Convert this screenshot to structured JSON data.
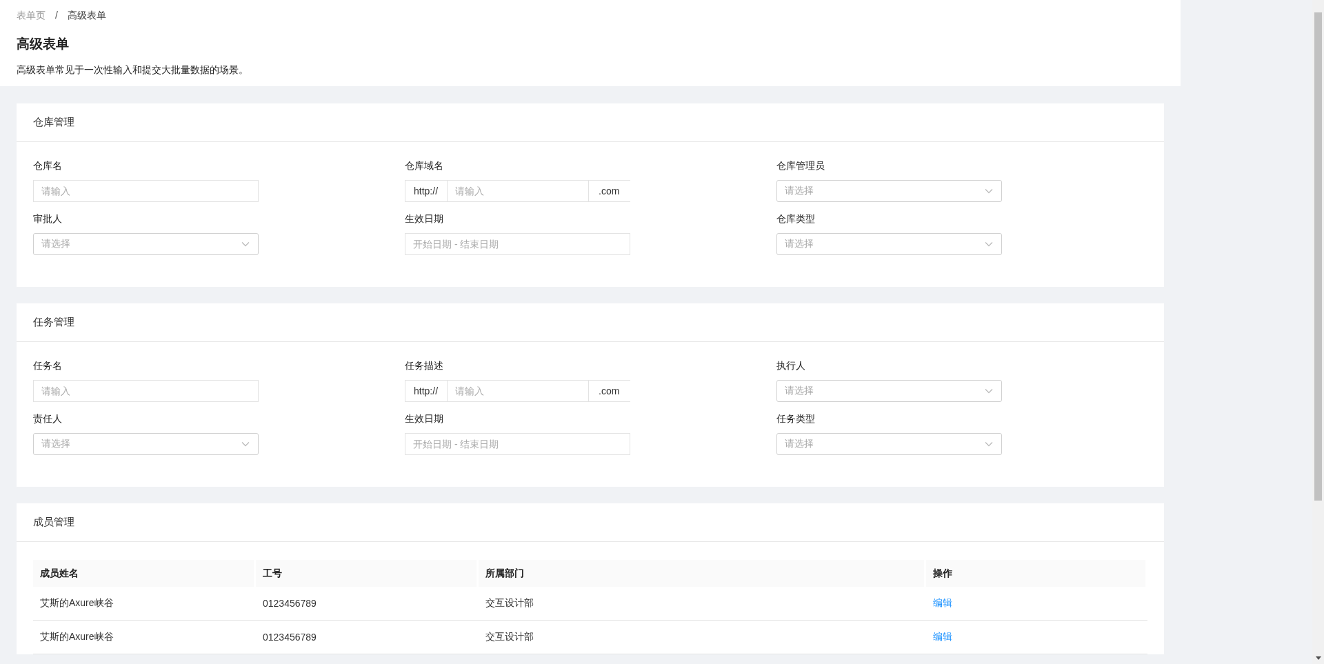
{
  "breadcrumb": [
    {
      "label": "表单页",
      "current": false
    },
    {
      "label": "高级表单",
      "current": true
    }
  ],
  "breadcrumb_separator": "/",
  "page": {
    "title": "高级表单",
    "description": "高级表单常见于一次性输入和提交大批量数据的场景。"
  },
  "sections": [
    {
      "title": "仓库管理",
      "kind": "form",
      "fields": [
        {
          "label": "仓库名",
          "kind": "input",
          "placeholder": "请输入"
        },
        {
          "label": "仓库域名",
          "kind": "addon_input",
          "prefix": "http://",
          "placeholder": "请输入",
          "suffix": ".com"
        },
        {
          "label": "仓库管理员",
          "kind": "select",
          "placeholder": "请选择"
        },
        {
          "label": "审批人",
          "kind": "select",
          "placeholder": "请选择"
        },
        {
          "label": "生效日期",
          "kind": "date_range",
          "placeholder": "开始日期 - 结束日期"
        },
        {
          "label": "仓库类型",
          "kind": "select",
          "placeholder": "请选择"
        }
      ]
    },
    {
      "title": "任务管理",
      "kind": "form",
      "fields": [
        {
          "label": "任务名",
          "kind": "input",
          "placeholder": "请输入"
        },
        {
          "label": "任务描述",
          "kind": "addon_input",
          "prefix": "http://",
          "placeholder": "请输入",
          "suffix": ".com"
        },
        {
          "label": "执行人",
          "kind": "select",
          "placeholder": "请选择"
        },
        {
          "label": "责任人",
          "kind": "select",
          "placeholder": "请选择"
        },
        {
          "label": "生效日期",
          "kind": "date_range",
          "placeholder": "开始日期 - 结束日期"
        },
        {
          "label": "任务类型",
          "kind": "select",
          "placeholder": "请选择"
        }
      ]
    },
    {
      "title": "成员管理",
      "kind": "table",
      "table": {
        "columns": [
          "成员姓名",
          "工号",
          "所属部门",
          "操作"
        ],
        "rows": [
          {
            "cells": [
              "艾斯的Axure峡谷",
              "0123456789",
              "交互设计部"
            ],
            "action": "编辑"
          },
          {
            "cells": [
              "艾斯的Axure峡谷",
              "0123456789",
              "交互设计部"
            ],
            "action": "编辑"
          }
        ]
      }
    }
  ]
}
